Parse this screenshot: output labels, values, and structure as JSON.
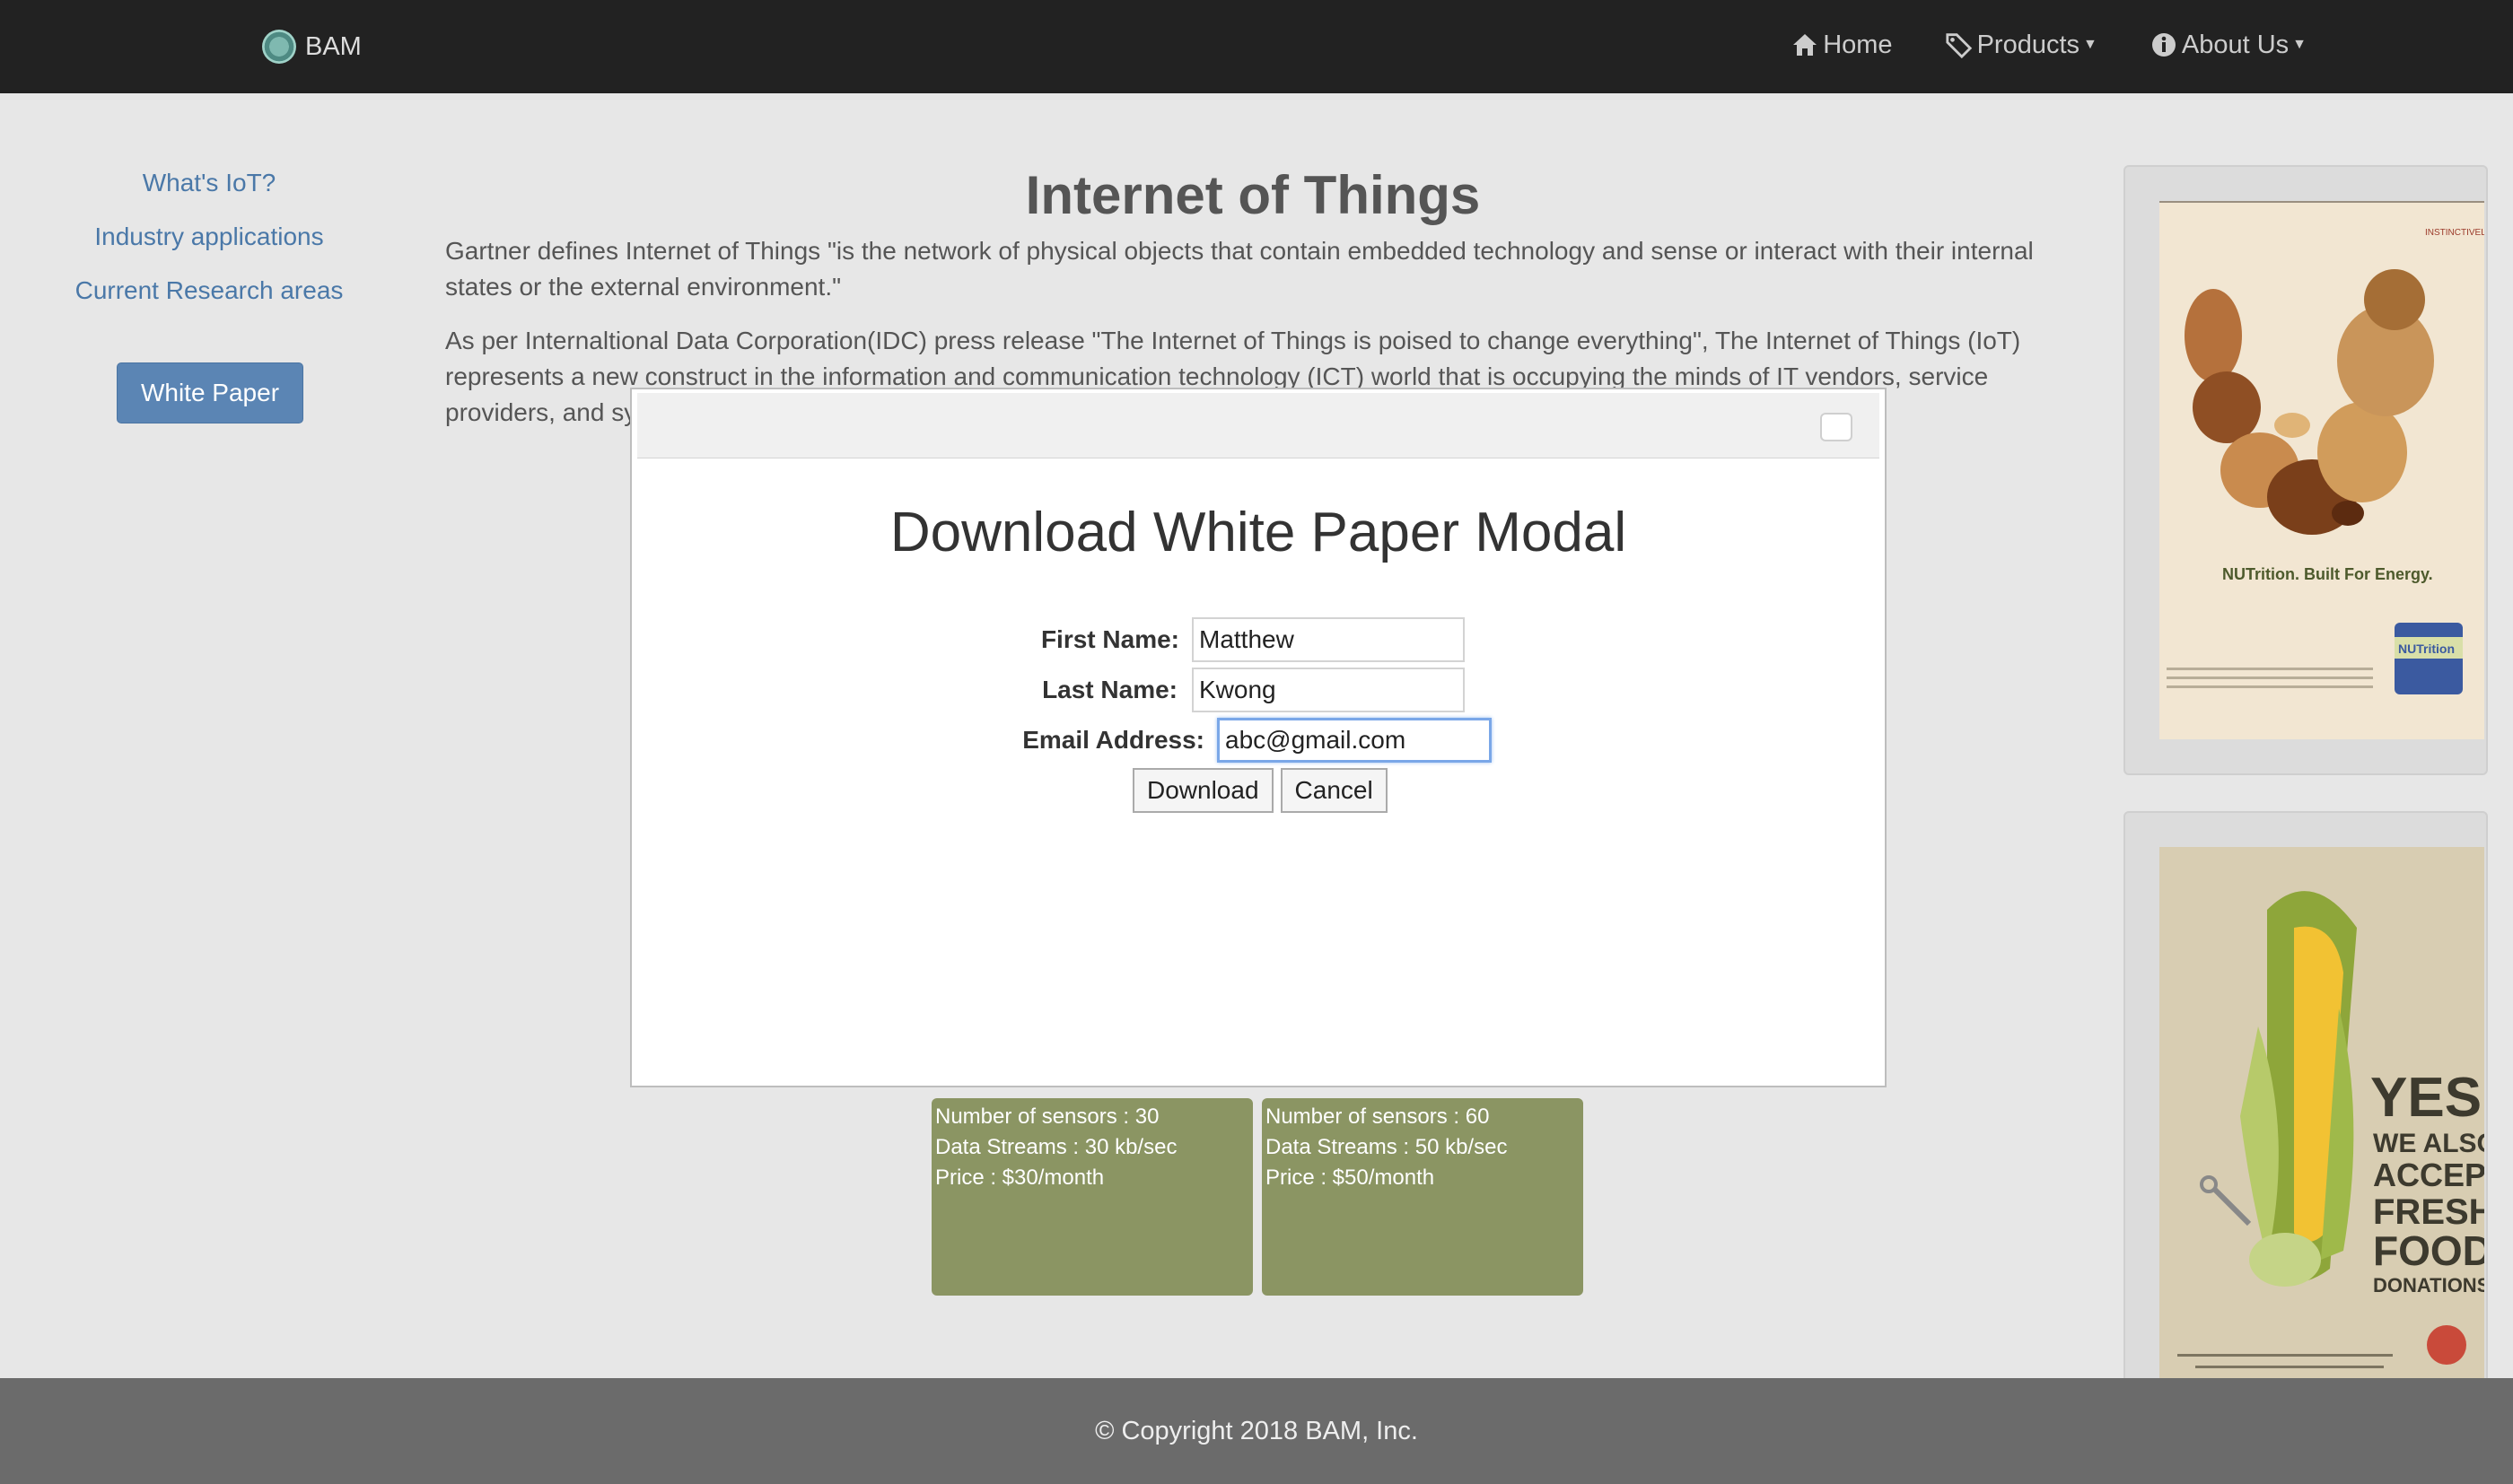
{
  "navbar": {
    "brand": "BAM",
    "items": [
      {
        "label": "Home",
        "icon": "home-icon"
      },
      {
        "label": "Products",
        "icon": "tags-icon",
        "dropdown": true
      },
      {
        "label": "About Us",
        "icon": "info-icon",
        "dropdown": true
      }
    ]
  },
  "sidebar": {
    "links": [
      "What's IoT?",
      "Industry applications",
      "Current Research areas"
    ],
    "button": "White Paper"
  },
  "main": {
    "title": "Internet of Things",
    "paragraph1": "Gartner defines Internet of Things \"is the network of physical objects that contain embedded technology and sense or interact with their internal states or the external environment.\"",
    "paragraph2": "As per Internaltional Data Corporation(IDC) press release \"The Internet of Things is poised to change everything\", The Internet of Things (IoT) represents a new construct in the information and communication technology (ICT) world that is occupying the minds of IT vendors, service providers, and sy"
  },
  "tiles": [
    {
      "sensors": "Number of sensors : 30",
      "streams": "Data Streams : 30 kb/sec",
      "price": "Price : $30/month"
    },
    {
      "sensors": "Number of sensors : 60",
      "streams": "Data Streams : 50 kb/sec",
      "price": "Price : $50/month"
    }
  ],
  "ads": [
    {
      "headline": "NUTrition. Built For Energy.",
      "brand": "INSTINCTIVELY GOOD",
      "can": "NUTrition"
    },
    {
      "line1": "YES",
      "line2": "WE ALSO",
      "line3": "ACCEPT",
      "line4": "FRESH",
      "line5": "FOOD",
      "line6": "DONATIONS"
    }
  ],
  "modal": {
    "title": "Download White Paper Modal",
    "first_name_label": "First Name:",
    "first_name_value": "Matthew",
    "last_name_label": "Last Name:",
    "last_name_value": "Kwong",
    "email_label": "Email Address:",
    "email_value": "abc@gmail.com",
    "download": "Download",
    "cancel": "Cancel"
  },
  "footer": {
    "copyright": "© Copyright 2018 BAM, Inc."
  },
  "colors": {
    "navbar": "#222222",
    "link": "#4a78a8",
    "button": "#5b85b4",
    "tile": "#8b9563",
    "footer": "#6b6b6b"
  }
}
